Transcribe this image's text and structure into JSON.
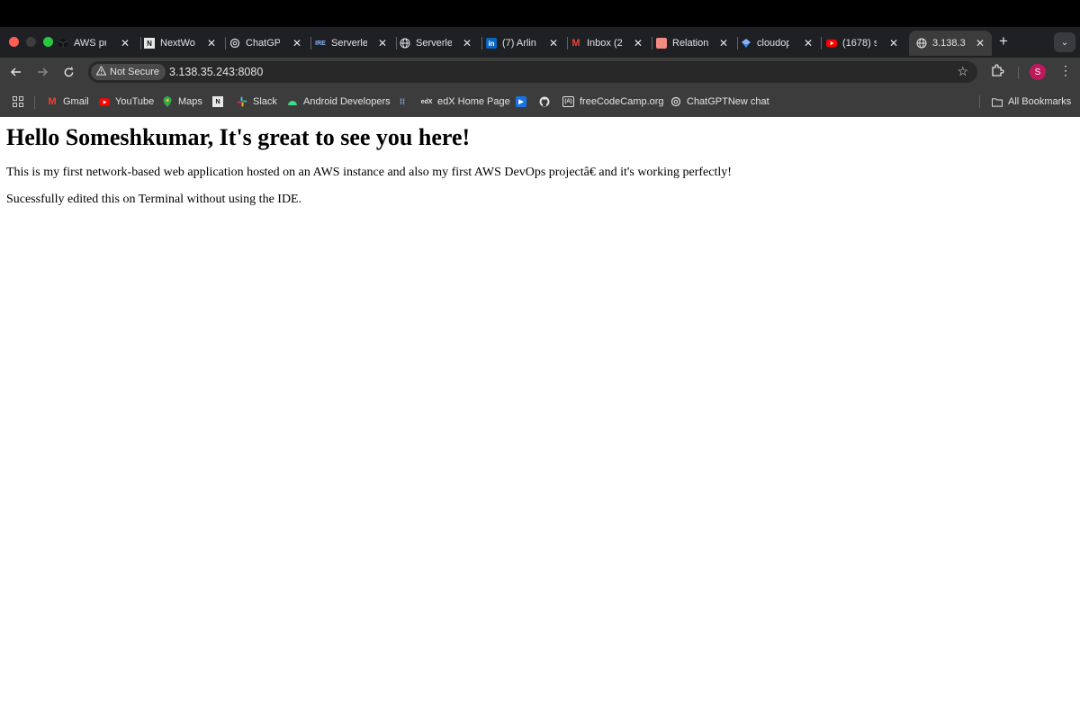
{
  "browser": {
    "tabs": [
      {
        "label": "AWS pr",
        "icon": "aws-cube-icon"
      },
      {
        "label": "NextWo",
        "icon": "nextwork-icon"
      },
      {
        "label": "ChatGP",
        "icon": "openai-icon"
      },
      {
        "label": "Serverle",
        "icon": "serverless-ire-icon"
      },
      {
        "label": "Serverle",
        "icon": "globe-icon"
      },
      {
        "label": "(7) Arlin",
        "icon": "linkedin-icon"
      },
      {
        "label": "Inbox (2",
        "icon": "gmail-icon"
      },
      {
        "label": "Relation",
        "icon": "relation-icon"
      },
      {
        "label": "cloudop",
        "icon": "cloudops-icon"
      },
      {
        "label": "(1678) s",
        "icon": "youtube-icon"
      },
      {
        "label": "3.138.3",
        "icon": "globe-icon"
      }
    ],
    "active_tab_index": 10,
    "security_label": "Not Secure",
    "url": "3.138.35.243:8080",
    "profile_initial": "S",
    "bookmarks": [
      {
        "label": "Gmail",
        "icon": "gmail-icon"
      },
      {
        "label": "YouTube",
        "icon": "youtube-icon"
      },
      {
        "label": "Maps",
        "icon": "maps-pin-icon"
      },
      {
        "label": "",
        "icon": "nextwork-icon"
      },
      {
        "label": "Slack",
        "icon": "slack-icon"
      },
      {
        "label": "Android Developers",
        "icon": "android-icon"
      },
      {
        "label": "",
        "icon": "bookmark-favicon-icon"
      },
      {
        "label": "edX Home Page",
        "icon": "edx-icon"
      },
      {
        "label": "",
        "icon": "play-icon"
      },
      {
        "label": "",
        "icon": "github-icon"
      },
      {
        "label": "freeCodeCamp.org",
        "icon": "freecodecamp-icon"
      },
      {
        "label": "ChatGPTNew chat",
        "icon": "openai-icon"
      }
    ],
    "all_bookmarks_label": "All Bookmarks"
  },
  "page": {
    "heading": "Hello Someshkumar, It's great to see you here!",
    "paragraph1": "This is my first network-based web application hosted on an AWS instance and also my first AWS DevOps projectâ€   and it's working perfectly!",
    "paragraph2": "Sucessfully edited this on Terminal without using the IDE."
  },
  "colors": {
    "tabstrip_bg": "#1f2023",
    "toolbar_bg": "#3c3c3c",
    "close_dot": "#ff5f57",
    "min_dot": "#3d3d3d",
    "zoom_dot": "#28c840",
    "avatar": "#c0185c"
  }
}
